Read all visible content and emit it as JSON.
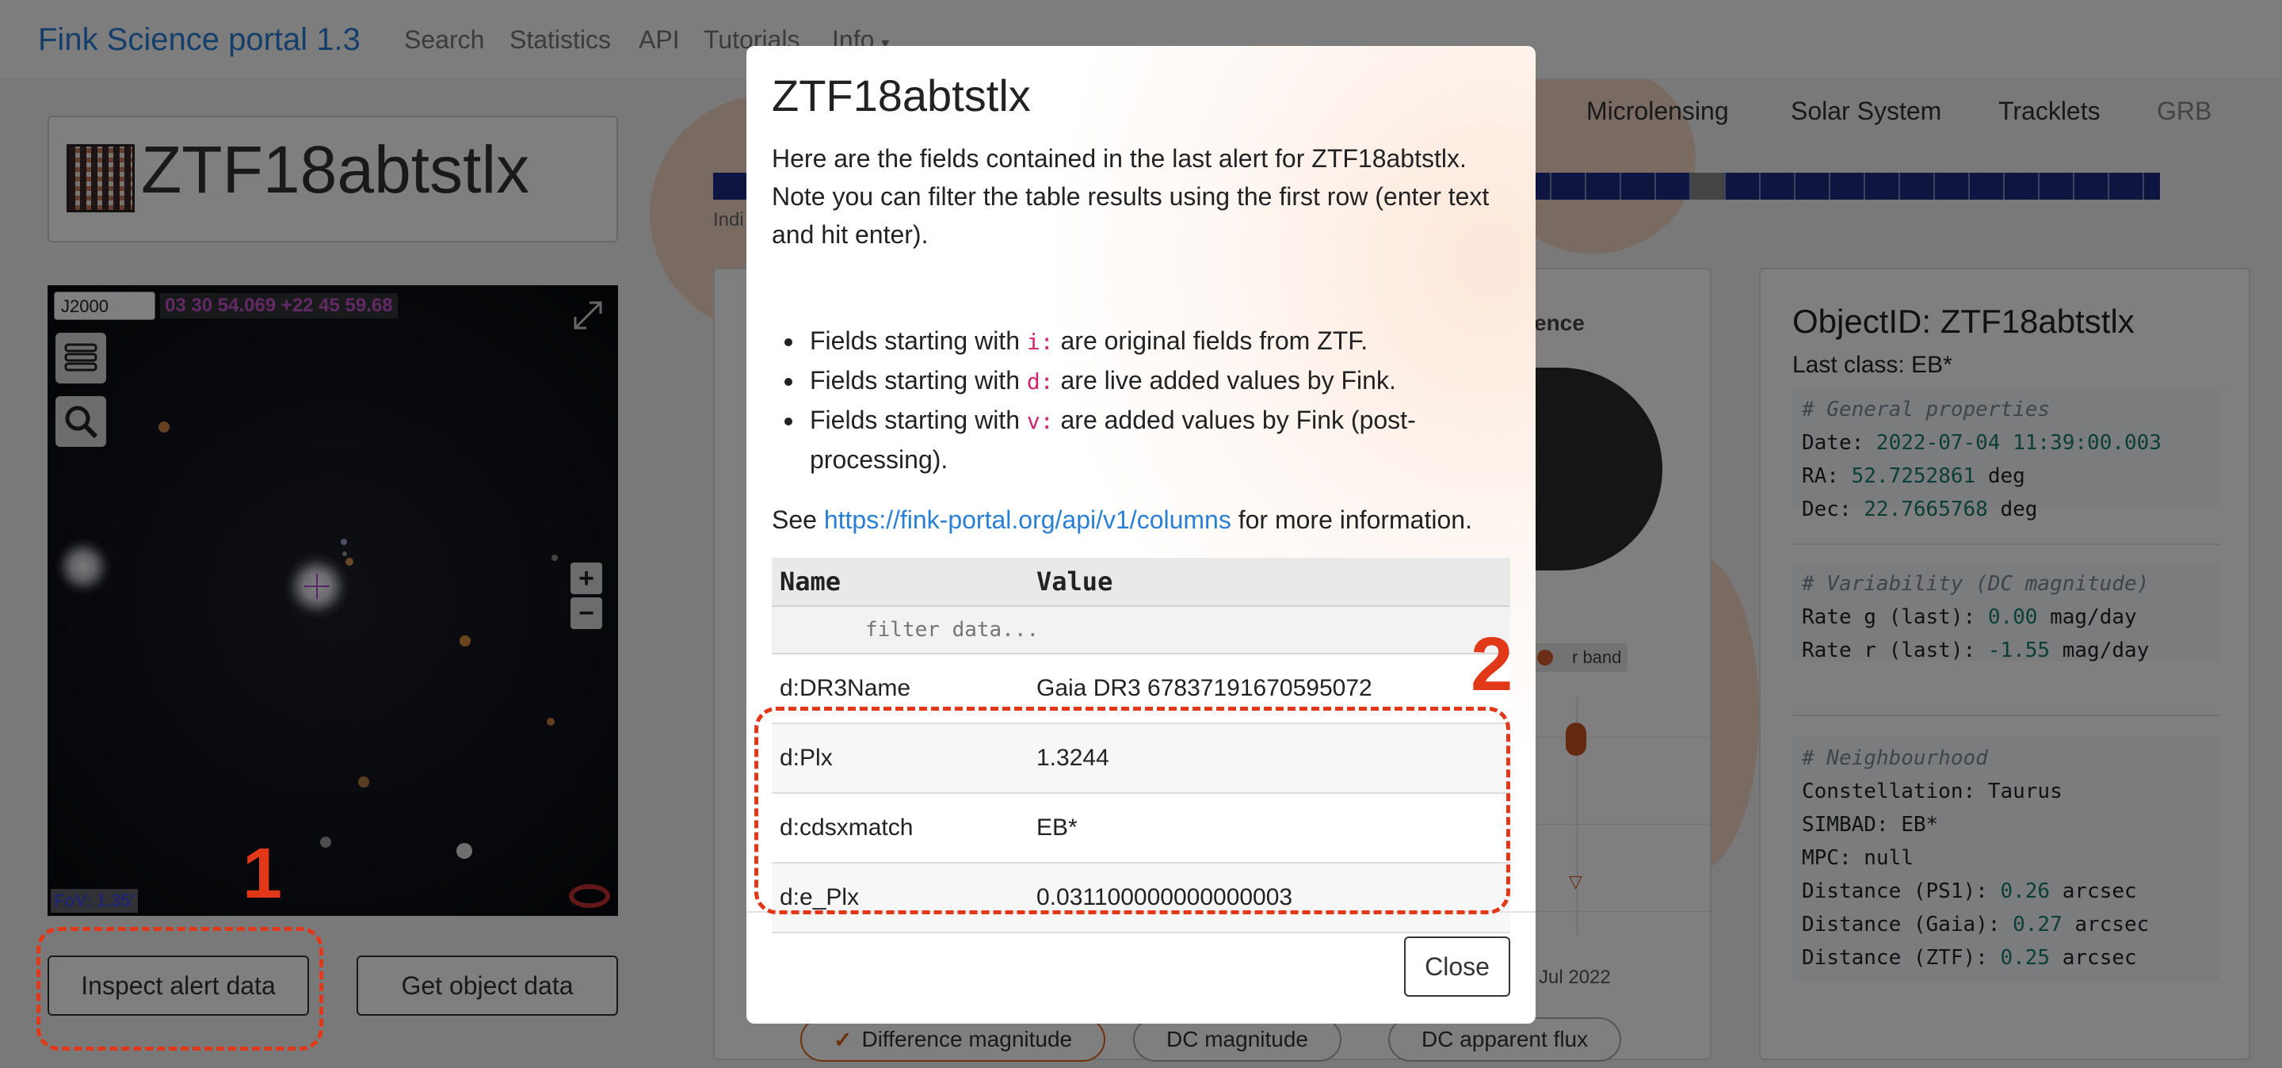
{
  "navbar": {
    "brand": "Fink Science portal 1.3",
    "links": [
      "Search",
      "Statistics",
      "API",
      "Tutorials"
    ],
    "info_label": "Info",
    "info_caret": "▾"
  },
  "object": {
    "title": "ZTF18abtstlx"
  },
  "viewer": {
    "frame": "J2000",
    "coords": "03 30 54.069 +22 45 59.68",
    "fov": "FoV: 1.35'",
    "zoom_in": "+",
    "zoom_out": "−"
  },
  "buttons": {
    "inspect": "Inspect alert data",
    "get_object": "Get object data"
  },
  "tabs": [
    "Microlensing",
    "Solar System",
    "Tracklets",
    "GRB"
  ],
  "indi_text": "Indi",
  "mid": {
    "partial_label": "ence",
    "rband": "r band",
    "xtick": "Jul 2022"
  },
  "chips": [
    {
      "label": "Difference magnitude",
      "check": "✓"
    },
    {
      "label": "DC magnitude"
    },
    {
      "label": "DC apparent flux"
    }
  ],
  "info": {
    "title": "ObjectID: ZTF18abtstlx",
    "last_class": "Last class: EB*",
    "general": {
      "header": "# General properties",
      "date_label": "Date: ",
      "date_value": "2022-07-04",
      "time_value": "11:39:00.003",
      "ra_label": "RA: ",
      "ra_value": "52.7252861",
      "dec_label": "Dec: ",
      "dec_value": "22.7665768",
      "unit_deg": " deg"
    },
    "variability": {
      "header": "# Variability (DC magnitude)",
      "g_label": "Rate g (last): ",
      "g_value": "0.00",
      "r_label": "Rate r (last): ",
      "r_value": "-1.55",
      "unit": " mag/day"
    },
    "neighbourhood": {
      "header": "# Neighbourhood",
      "constellation": "Constellation: Taurus",
      "simbad": "SIMBAD: EB*",
      "mpc": "MPC: null",
      "ps1_label": "Distance (PS1): ",
      "ps1_value": "0.26",
      "gaia_label": "Distance (Gaia): ",
      "gaia_value": "0.27",
      "ztf_label": "Distance (ZTF): ",
      "ztf_value": "0.25",
      "unit": " arcsec"
    }
  },
  "modal": {
    "title": "ZTF18abtstlx",
    "intro": "Here are the fields contained in the last alert for ZTF18abtstlx. Note you can filter the table results using the first row (enter text and hit enter).",
    "bullets": [
      {
        "pre": "Fields starting with ",
        "code": "i:",
        "post": " are original fields from ZTF."
      },
      {
        "pre": "Fields starting with ",
        "code": "d:",
        "post": " are live added values by Fink."
      },
      {
        "pre": "Fields starting with ",
        "code": "v:",
        "post": " are added values by Fink (post-processing)."
      }
    ],
    "see_pre": "See ",
    "see_link": "https://fink-portal.org/api/v1/columns",
    "see_post": " for more information.",
    "table": {
      "col_name": "Name",
      "col_value": "Value",
      "filter_placeholder": "filter data...",
      "rows": [
        {
          "name": "d:DR3Name",
          "value": "Gaia DR3 67837191670595072"
        },
        {
          "name": "d:Plx",
          "value": "1.3244"
        },
        {
          "name": "d:cdsxmatch",
          "value": "EB*"
        },
        {
          "name": "d:e_Plx",
          "value": "0.031100000000000003"
        }
      ]
    },
    "close_label": "Close"
  },
  "annotations": {
    "one": "1",
    "two": "2"
  },
  "colors": {
    "accent": "#2a7fd4",
    "annotation": "#e2381a",
    "chip_active": "#e0641c",
    "code_pink": "#d0256e"
  }
}
